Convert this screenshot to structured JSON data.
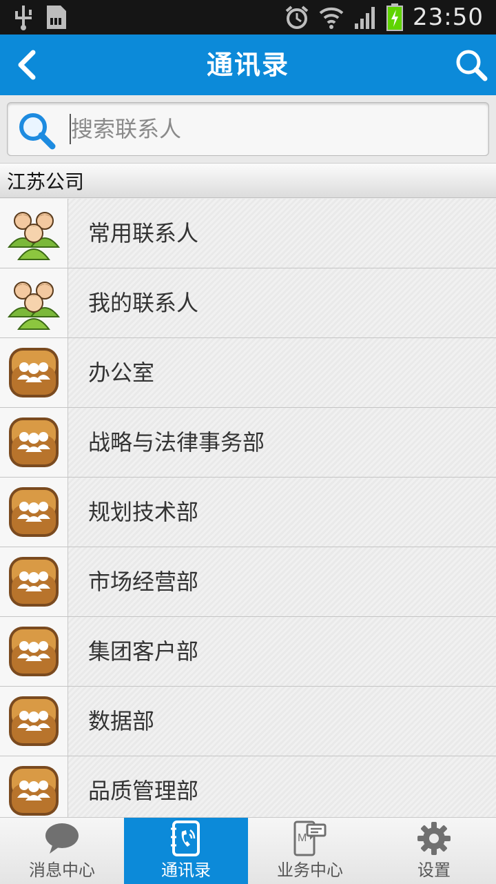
{
  "status_bar": {
    "time": "23:50"
  },
  "header": {
    "title": "通讯录"
  },
  "search": {
    "placeholder": "搜索联系人"
  },
  "group": {
    "name": "江苏公司"
  },
  "contacts": [
    {
      "label": "常用联系人",
      "icon": "people-group-icon"
    },
    {
      "label": "我的联系人",
      "icon": "people-group-icon"
    },
    {
      "label": "办公室",
      "icon": "department-icon"
    },
    {
      "label": "战略与法律事务部",
      "icon": "department-icon"
    },
    {
      "label": "规划技术部",
      "icon": "department-icon"
    },
    {
      "label": "市场经营部",
      "icon": "department-icon"
    },
    {
      "label": "集团客户部",
      "icon": "department-icon"
    },
    {
      "label": "数据部",
      "icon": "department-icon"
    },
    {
      "label": "品质管理部",
      "icon": "department-icon"
    }
  ],
  "tabs": [
    {
      "label": "消息中心",
      "icon": "chat-bubble-icon",
      "active": false
    },
    {
      "label": "通讯录",
      "icon": "address-book-icon",
      "active": true
    },
    {
      "label": "业务中心",
      "icon": "business-icon",
      "active": false
    },
    {
      "label": "设置",
      "icon": "gear-icon",
      "active": false
    }
  ],
  "colors": {
    "accent": "#0c8ad9",
    "status_bar": "#151515",
    "battery": "#5fd400"
  }
}
